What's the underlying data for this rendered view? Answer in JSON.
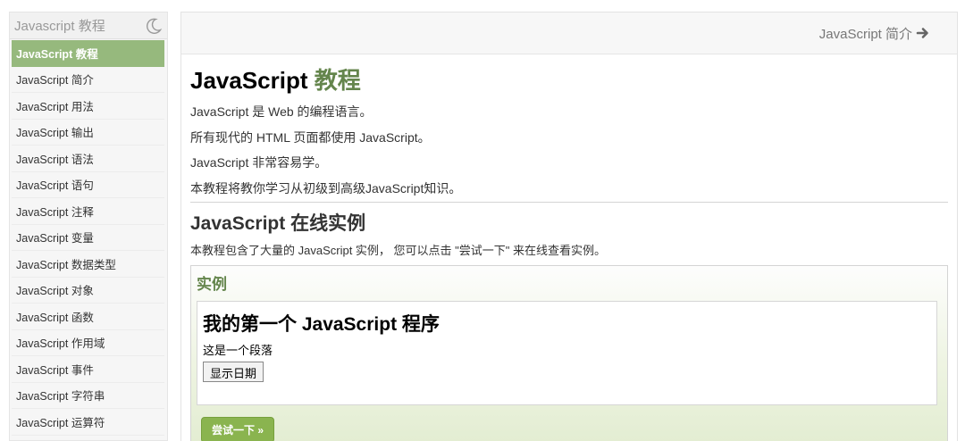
{
  "sidebar": {
    "title": "Javascript 教程",
    "theme_toggle_icon": "moon-icon",
    "items": [
      {
        "label": "JavaScript 教程",
        "active": true
      },
      {
        "label": "JavaScript 简介"
      },
      {
        "label": "JavaScript 用法"
      },
      {
        "label": "JavaScript 输出"
      },
      {
        "label": "JavaScript 语法"
      },
      {
        "label": "JavaScript 语句"
      },
      {
        "label": "JavaScript 注释"
      },
      {
        "label": "JavaScript 变量"
      },
      {
        "label": "JavaScript 数据类型"
      },
      {
        "label": "JavaScript 对象"
      },
      {
        "label": "JavaScript 函数"
      },
      {
        "label": "JavaScript 作用域"
      },
      {
        "label": "JavaScript 事件"
      },
      {
        "label": "JavaScript 字符串"
      },
      {
        "label": "JavaScript 运算符"
      }
    ]
  },
  "top_nav": {
    "next_label": "JavaScript 简介",
    "next_icon": "arrow-right-icon"
  },
  "main": {
    "title_prefix": "JavaScript",
    "title_highlight": "教程",
    "intro": [
      "JavaScript 是 Web 的编程语言。",
      "所有现代的 HTML 页面都使用 JavaScript。",
      "JavaScript 非常容易学。",
      "本教程将教你学习从初级到高级JavaScript知识。"
    ],
    "section_title": "JavaScript 在线实例",
    "section_desc": "本教程包含了大量的 JavaScript 实例， 您可以点击 \"尝试一下\" 来在线查看实例。",
    "example": {
      "title": "实例",
      "demo_heading": "我的第一个 JavaScript 程序",
      "demo_paragraph": "这是一个段落",
      "demo_button": "显示日期",
      "try_button": "尝试一下 »"
    }
  },
  "colors": {
    "accent_green": "#96b97d",
    "title_green": "#64854c",
    "try_button": "#8ab44f"
  }
}
